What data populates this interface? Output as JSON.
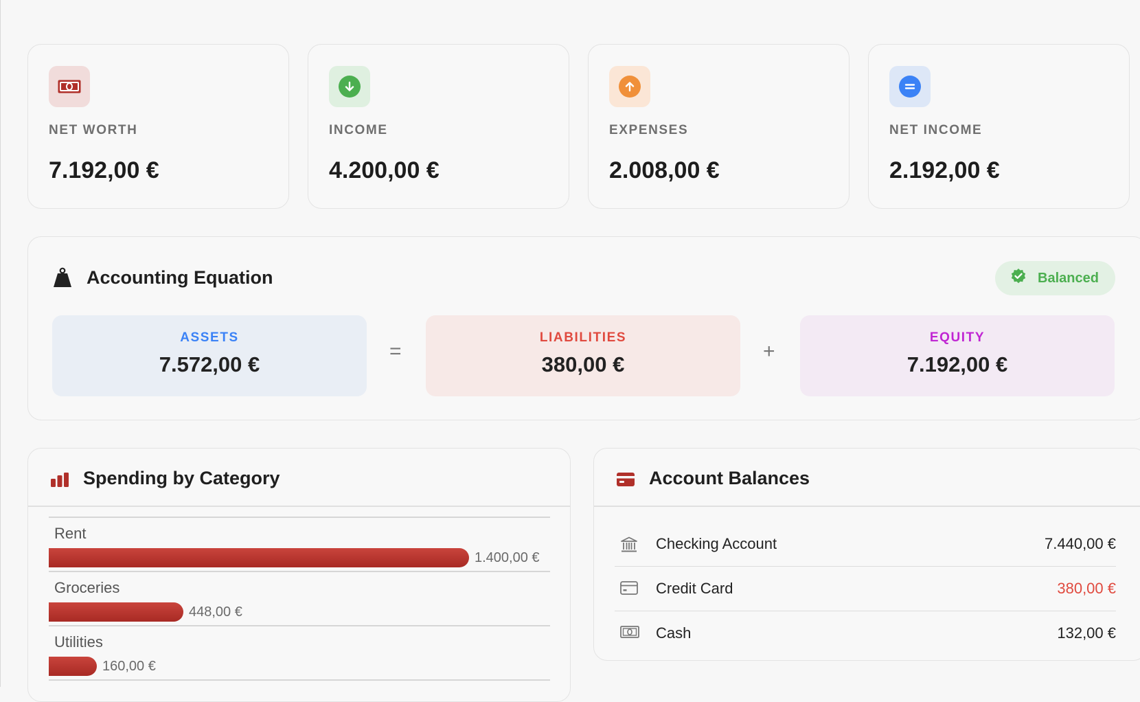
{
  "stats": [
    {
      "label": "NET WORTH",
      "value": "7.192,00 €",
      "icon": "banknote-icon"
    },
    {
      "label": "INCOME",
      "value": "4.200,00 €",
      "icon": "arrow-down-circle-icon"
    },
    {
      "label": "EXPENSES",
      "value": "2.008,00 €",
      "icon": "arrow-up-circle-icon"
    },
    {
      "label": "NET INCOME",
      "value": "2.192,00 €",
      "icon": "equals-circle-icon"
    }
  ],
  "equation": {
    "title": "Accounting Equation",
    "badge": "Balanced",
    "assets": {
      "label": "ASSETS",
      "value": "7.572,00 €"
    },
    "liabilities": {
      "label": "LIABILITIES",
      "value": "380,00 €"
    },
    "equity": {
      "label": "EQUITY",
      "value": "7.192,00 €"
    },
    "op_equals": "=",
    "op_plus": "+"
  },
  "spending": {
    "title": "Spending by Category",
    "categories": [
      {
        "name": "Rent",
        "amount": "1.400,00 €",
        "value": 1400
      },
      {
        "name": "Groceries",
        "amount": "448,00 €",
        "value": 448
      },
      {
        "name": "Utilities",
        "amount": "160,00 €",
        "value": 160
      }
    ]
  },
  "accounts": {
    "title": "Account Balances",
    "items": [
      {
        "name": "Checking Account",
        "value": "7.440,00 €",
        "icon": "bank-icon"
      },
      {
        "name": "Credit Card",
        "value": "380,00 €",
        "icon": "credit-card-icon"
      },
      {
        "name": "Cash",
        "value": "132,00 €",
        "icon": "banknote-icon"
      }
    ]
  },
  "colors": {
    "brand_red": "#b0302a",
    "income_green": "#4caf50",
    "expense_orange": "#f0903a",
    "net_blue": "#3b82f6",
    "assets_blue": "#3b82f6",
    "liabilities_red": "#e04a3f",
    "equity_purple": "#c026d3",
    "negative_value": "#e04a3f"
  }
}
